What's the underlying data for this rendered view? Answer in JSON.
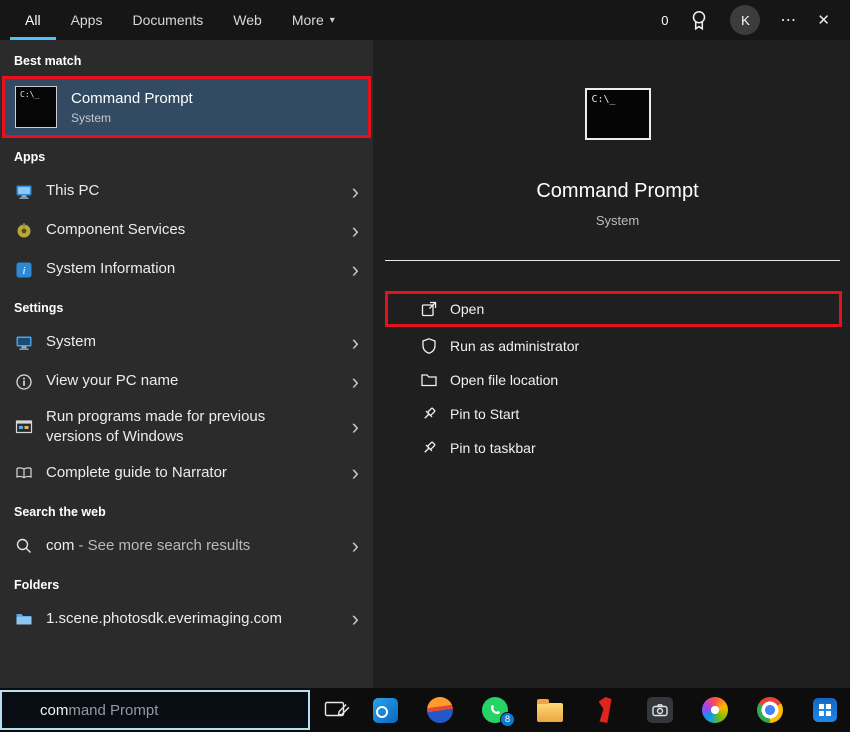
{
  "colors": {
    "accent_blue": "#4cc2ff",
    "annotation_red": "#e8101c",
    "highlight_row": "#334a63"
  },
  "icons": {
    "chevron_down": "▾",
    "chevron_right": "›",
    "more": "⋯",
    "close": "✕",
    "cmd_prompt_text": "C:\\_"
  },
  "topbar": {
    "tabs": [
      "All",
      "Apps",
      "Documents",
      "Web",
      "More"
    ],
    "rewards_count": "0",
    "avatar_initial": "K"
  },
  "left_panel": {
    "best_match_header": "Best match",
    "best_match": {
      "title": "Command Prompt",
      "subtitle": "System"
    },
    "apps_header": "Apps",
    "apps": [
      "This PC",
      "Component Services",
      "System Information"
    ],
    "settings_header": "Settings",
    "settings": [
      "System",
      "View your PC name",
      "Run programs made for previous versions of Windows",
      "Complete guide to Narrator"
    ],
    "web_header": "Search the web",
    "web_result": {
      "query": "com",
      "suffix": " - See more search results"
    },
    "folders_header": "Folders",
    "folders": [
      "1.scene.photosdk.everimaging.com"
    ]
  },
  "preview": {
    "title": "Command Prompt",
    "subtitle": "System",
    "actions": [
      "Open",
      "Run as administrator",
      "Open file location",
      "Pin to Start",
      "Pin to taskbar"
    ]
  },
  "taskbar": {
    "search_typed": "com",
    "search_suggestion": "mand Prompt",
    "whatsapp_badge": "8"
  }
}
